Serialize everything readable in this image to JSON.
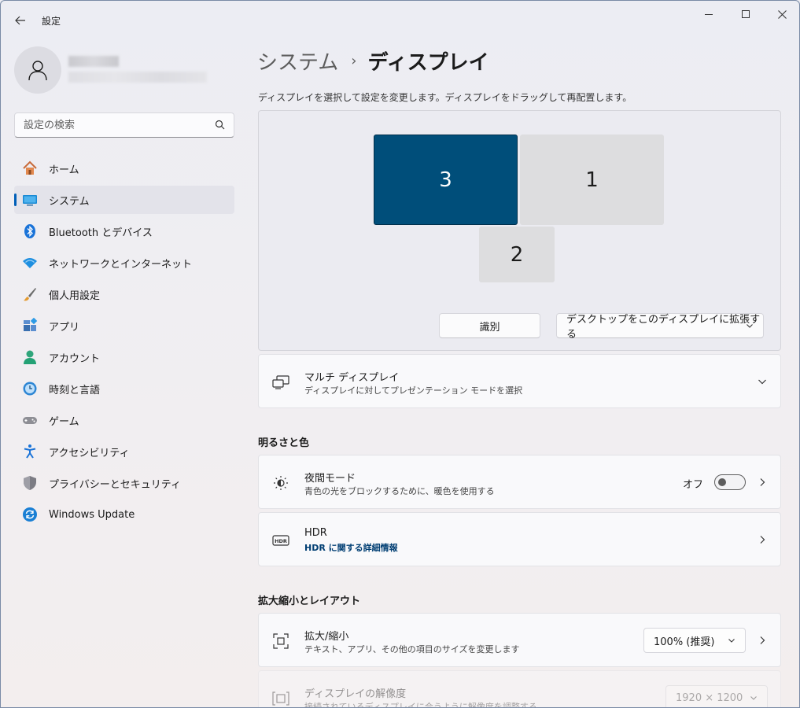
{
  "window": {
    "title": "設定",
    "back_icon": "back-arrow-icon",
    "controls": [
      "minimize-icon",
      "maximize-icon",
      "close-icon"
    ]
  },
  "search": {
    "placeholder": "設定の検索",
    "icon": "search-icon"
  },
  "sidebar": {
    "items": [
      {
        "label": "ホーム",
        "icon": "home-icon",
        "selected": false
      },
      {
        "label": "システム",
        "icon": "system-icon",
        "selected": true
      },
      {
        "label": "Bluetooth とデバイス",
        "icon": "bluetooth-icon",
        "selected": false
      },
      {
        "label": "ネットワークとインターネット",
        "icon": "wifi-icon",
        "selected": false
      },
      {
        "label": "個人用設定",
        "icon": "brush-icon",
        "selected": false
      },
      {
        "label": "アプリ",
        "icon": "apps-icon",
        "selected": false
      },
      {
        "label": "アカウント",
        "icon": "account-icon",
        "selected": false
      },
      {
        "label": "時刻と言語",
        "icon": "time-language-icon",
        "selected": false
      },
      {
        "label": "ゲーム",
        "icon": "gamepad-icon",
        "selected": false
      },
      {
        "label": "アクセシビリティ",
        "icon": "accessibility-icon",
        "selected": false
      },
      {
        "label": "プライバシーとセキュリティ",
        "icon": "shield-icon",
        "selected": false
      },
      {
        "label": "Windows Update",
        "icon": "update-icon",
        "selected": false
      }
    ]
  },
  "breadcrumb": {
    "parent": "システム",
    "separator": "›",
    "current": "ディスプレイ"
  },
  "description": "ディスプレイを選択して設定を変更します。ディスプレイをドラッグして再配置します。",
  "arranger": {
    "monitors": [
      {
        "number": "3",
        "selected": true
      },
      {
        "number": "1",
        "selected": false
      },
      {
        "number": "2",
        "selected": false
      }
    ],
    "identify_label": "識別",
    "extend_label": "デスクトップをこのディスプレイに拡張する"
  },
  "multi_display": {
    "title": "マルチ ディスプレイ",
    "subtitle": "ディスプレイに対してプレゼンテーション モードを選択"
  },
  "section_brightness": "明るさと色",
  "night_light": {
    "title": "夜間モード",
    "subtitle": "青色の光をブロックするために、暖色を使用する",
    "state_label": "オフ",
    "on": false
  },
  "hdr": {
    "title": "HDR",
    "link": "HDR に関する詳細情報"
  },
  "section_scale": "拡大縮小とレイアウト",
  "scale": {
    "title": "拡大/縮小",
    "subtitle": "テキスト、アプリ、その他の項目のサイズを変更します",
    "value": "100% (推奨)"
  },
  "resolution": {
    "title": "ディスプレイの解像度",
    "subtitle": "接続されているディスプレイに合うように解像度を調整する",
    "value": "1920 × 1200"
  },
  "colors": {
    "accent": "#005fb8",
    "selected_monitor": "#004e7a",
    "link": "#003e73"
  }
}
